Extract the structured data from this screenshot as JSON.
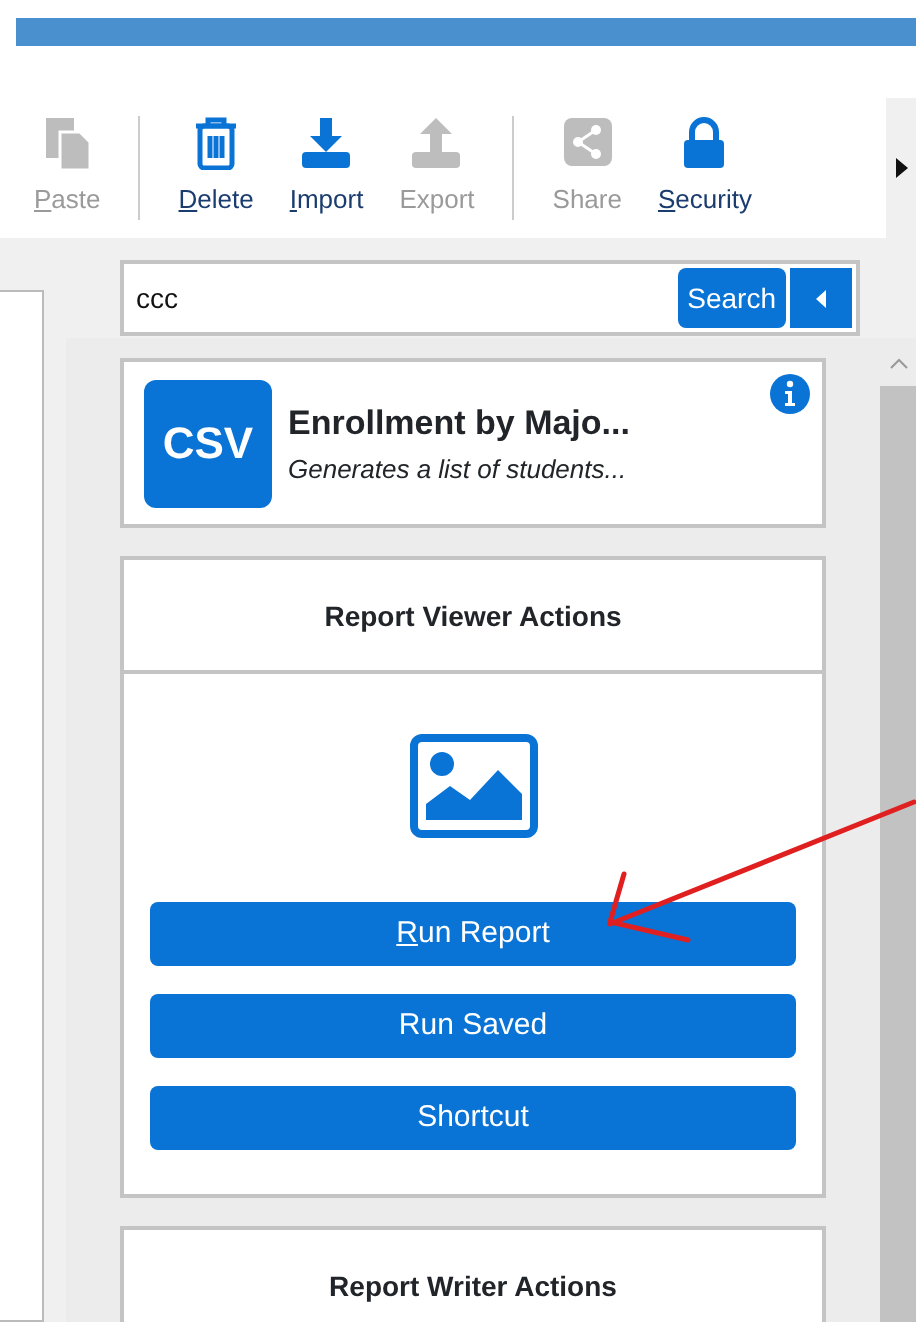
{
  "toolbar": [
    {
      "label": "Paste",
      "kind": "paste",
      "disabled": true,
      "access_key": true
    },
    {
      "kind": "separator"
    },
    {
      "label": "Delete",
      "kind": "trash",
      "disabled": false,
      "access_key": true
    },
    {
      "label": "Import",
      "kind": "import",
      "disabled": false,
      "access_key": true
    },
    {
      "label": "Export",
      "kind": "export",
      "disabled": true,
      "access_key": false
    },
    {
      "kind": "separator"
    },
    {
      "label": "Share",
      "kind": "share",
      "disabled": true,
      "access_key": false
    },
    {
      "label": "Security",
      "kind": "lock",
      "disabled": false,
      "access_key": true
    }
  ],
  "search": {
    "value": "ccc",
    "button": "Search"
  },
  "report": {
    "badge": "CSV",
    "title": "Enrollment by Majo...",
    "description": "Generates a list of students..."
  },
  "panels": [
    {
      "title": "Report Viewer Actions",
      "buttons": [
        {
          "label": "Run Report",
          "access_key": true
        },
        {
          "label": "Run Saved",
          "access_key": false
        },
        {
          "label": "Shortcut",
          "access_key": false
        }
      ]
    },
    {
      "title": "Report Writer Actions"
    }
  ]
}
